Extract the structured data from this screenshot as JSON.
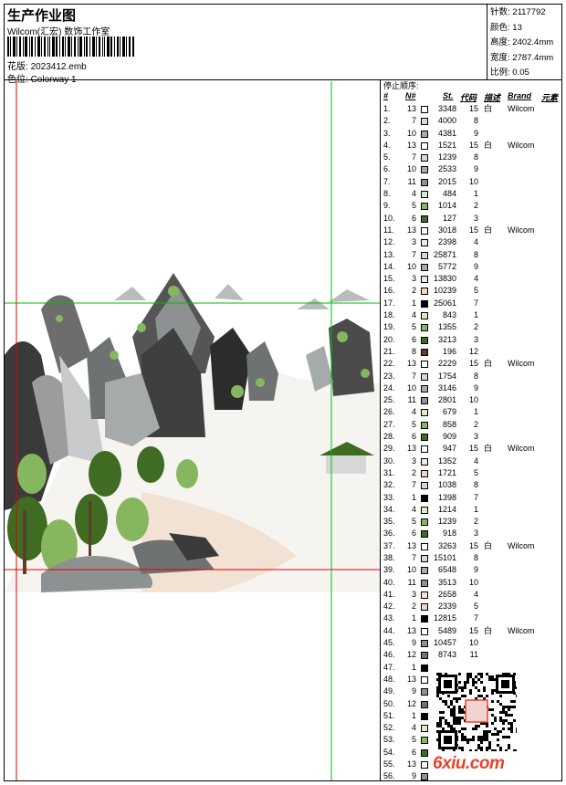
{
  "header": {
    "title": "生产作业图",
    "studio": "Wilcom(汇宏) 数饰工作室",
    "file_label": "花版:",
    "file_name": "2023412.emb",
    "colorway_label": "色位:",
    "colorway_name": "Colorway 1"
  },
  "stats": [
    {
      "label": "针数:",
      "value": "2117792"
    },
    {
      "label": "颜色:",
      "value": "13"
    },
    {
      "label": "高度:",
      "value": "2402.4mm"
    },
    {
      "label": "宽度:",
      "value": "2787.4mm"
    },
    {
      "label": "比例:",
      "value": "0.05"
    }
  ],
  "legend": {
    "title": "停止顺序:",
    "headers": {
      "num": "#",
      "n": "N#",
      "st": "St.",
      "code": "代码",
      "desc": "描述",
      "brand": "Brand",
      "elem": "元素"
    },
    "rows": [
      {
        "no": "1.",
        "n": "13",
        "st": "3348",
        "code": "15",
        "desc": "白",
        "brand": "Wilcom",
        "color": "#ffffff"
      },
      {
        "no": "2.",
        "n": "7",
        "st": "4000",
        "code": "8",
        "desc": "",
        "brand": "",
        "color": "#d6d8d8"
      },
      {
        "no": "3.",
        "n": "10",
        "st": "4381",
        "code": "9",
        "desc": "",
        "brand": "",
        "color": "#a7aaab"
      },
      {
        "no": "4.",
        "n": "13",
        "st": "1521",
        "code": "15",
        "desc": "白",
        "brand": "Wilcom",
        "color": "#ffffff"
      },
      {
        "no": "5.",
        "n": "7",
        "st": "1239",
        "code": "8",
        "desc": "",
        "brand": "",
        "color": "#d6d8d8"
      },
      {
        "no": "6.",
        "n": "10",
        "st": "2533",
        "code": "9",
        "desc": "",
        "brand": "",
        "color": "#a7aaab"
      },
      {
        "no": "7.",
        "n": "11",
        "st": "2015",
        "code": "10",
        "desc": "",
        "brand": "",
        "color": "#8d9192"
      },
      {
        "no": "8.",
        "n": "4",
        "st": "484",
        "code": "1",
        "desc": "",
        "brand": "",
        "color": "#d7edc8"
      },
      {
        "no": "9.",
        "n": "5",
        "st": "1014",
        "code": "2",
        "desc": "",
        "brand": "",
        "color": "#86b75e"
      },
      {
        "no": "10.",
        "n": "6",
        "st": "127",
        "code": "3",
        "desc": "",
        "brand": "",
        "color": "#3f6b22"
      },
      {
        "no": "11.",
        "n": "13",
        "st": "3018",
        "code": "15",
        "desc": "白",
        "brand": "Wilcom",
        "color": "#ffffff"
      },
      {
        "no": "12.",
        "n": "3",
        "st": "2398",
        "code": "4",
        "desc": "",
        "brand": "",
        "color": "#f1e7dc"
      },
      {
        "no": "13.",
        "n": "7",
        "st": "25871",
        "code": "8",
        "desc": "",
        "brand": "",
        "color": "#d6d8d8"
      },
      {
        "no": "14.",
        "n": "10",
        "st": "5772",
        "code": "9",
        "desc": "",
        "brand": "",
        "color": "#a7aaab"
      },
      {
        "no": "15.",
        "n": "3",
        "st": "13830",
        "code": "4",
        "desc": "",
        "brand": "",
        "color": "#f1e7dc"
      },
      {
        "no": "16.",
        "n": "2",
        "st": "10239",
        "code": "5",
        "desc": "",
        "brand": "",
        "color": "#ead8c8"
      },
      {
        "no": "17.",
        "n": "1",
        "st": "25061",
        "code": "7",
        "desc": "",
        "brand": "",
        "color": "#000000"
      },
      {
        "no": "18.",
        "n": "4",
        "st": "843",
        "code": "1",
        "desc": "",
        "brand": "",
        "color": "#d7edc8"
      },
      {
        "no": "19.",
        "n": "5",
        "st": "1355",
        "code": "2",
        "desc": "",
        "brand": "",
        "color": "#86b75e"
      },
      {
        "no": "20.",
        "n": "6",
        "st": "3213",
        "code": "3",
        "desc": "",
        "brand": "",
        "color": "#3f6b22"
      },
      {
        "no": "21.",
        "n": "8",
        "st": "196",
        "code": "12",
        "desc": "",
        "brand": "",
        "color": "#5b3f2a"
      },
      {
        "no": "22.",
        "n": "13",
        "st": "2229",
        "code": "15",
        "desc": "白",
        "brand": "Wilcom",
        "color": "#ffffff"
      },
      {
        "no": "23.",
        "n": "7",
        "st": "1754",
        "code": "8",
        "desc": "",
        "brand": "",
        "color": "#d6d8d8"
      },
      {
        "no": "24.",
        "n": "10",
        "st": "3146",
        "code": "9",
        "desc": "",
        "brand": "",
        "color": "#a7aaab"
      },
      {
        "no": "25.",
        "n": "11",
        "st": "2801",
        "code": "10",
        "desc": "",
        "brand": "",
        "color": "#8d9192"
      },
      {
        "no": "26.",
        "n": "4",
        "st": "679",
        "code": "1",
        "desc": "",
        "brand": "",
        "color": "#d7edc8"
      },
      {
        "no": "27.",
        "n": "5",
        "st": "858",
        "code": "2",
        "desc": "",
        "brand": "",
        "color": "#86b75e"
      },
      {
        "no": "28.",
        "n": "6",
        "st": "909",
        "code": "3",
        "desc": "",
        "brand": "",
        "color": "#3f6b22"
      },
      {
        "no": "29.",
        "n": "13",
        "st": "947",
        "code": "15",
        "desc": "白",
        "brand": "Wilcom",
        "color": "#ffffff"
      },
      {
        "no": "30.",
        "n": "3",
        "st": "1352",
        "code": "4",
        "desc": "",
        "brand": "",
        "color": "#f1e7dc"
      },
      {
        "no": "31.",
        "n": "2",
        "st": "1721",
        "code": "5",
        "desc": "",
        "brand": "",
        "color": "#ead8c8"
      },
      {
        "no": "32.",
        "n": "7",
        "st": "1038",
        "code": "8",
        "desc": "",
        "brand": "",
        "color": "#d6d8d8"
      },
      {
        "no": "33.",
        "n": "1",
        "st": "1398",
        "code": "7",
        "desc": "",
        "brand": "",
        "color": "#000000"
      },
      {
        "no": "34.",
        "n": "4",
        "st": "1214",
        "code": "1",
        "desc": "",
        "brand": "",
        "color": "#d7edc8"
      },
      {
        "no": "35.",
        "n": "5",
        "st": "1239",
        "code": "2",
        "desc": "",
        "brand": "",
        "color": "#86b75e"
      },
      {
        "no": "36.",
        "n": "6",
        "st": "918",
        "code": "3",
        "desc": "",
        "brand": "",
        "color": "#3f6b22"
      },
      {
        "no": "37.",
        "n": "13",
        "st": "3263",
        "code": "15",
        "desc": "白",
        "brand": "Wilcom",
        "color": "#ffffff"
      },
      {
        "no": "38.",
        "n": "7",
        "st": "15101",
        "code": "8",
        "desc": "",
        "brand": "",
        "color": "#d6d8d8"
      },
      {
        "no": "39.",
        "n": "10",
        "st": "6548",
        "code": "9",
        "desc": "",
        "brand": "",
        "color": "#a7aaab"
      },
      {
        "no": "40.",
        "n": "11",
        "st": "3513",
        "code": "10",
        "desc": "",
        "brand": "",
        "color": "#8d9192"
      },
      {
        "no": "41.",
        "n": "3",
        "st": "2658",
        "code": "4",
        "desc": "",
        "brand": "",
        "color": "#f1e7dc"
      },
      {
        "no": "42.",
        "n": "2",
        "st": "2339",
        "code": "5",
        "desc": "",
        "brand": "",
        "color": "#ead8c8"
      },
      {
        "no": "43.",
        "n": "1",
        "st": "12815",
        "code": "7",
        "desc": "",
        "brand": "",
        "color": "#000000"
      },
      {
        "no": "44.",
        "n": "13",
        "st": "5489",
        "code": "15",
        "desc": "白",
        "brand": "Wilcom",
        "color": "#ffffff"
      },
      {
        "no": "45.",
        "n": "9",
        "st": "10457",
        "code": "10",
        "desc": "",
        "brand": "",
        "color": "#8d9192"
      },
      {
        "no": "46.",
        "n": "12",
        "st": "8743",
        "code": "11",
        "desc": "",
        "brand": "",
        "color": "#6f7273"
      },
      {
        "no": "47.",
        "n": "1",
        "st": "",
        "code": "",
        "desc": "",
        "brand": "",
        "color": "#000000"
      },
      {
        "no": "48.",
        "n": "13",
        "st": "",
        "code": "",
        "desc": "",
        "brand": "",
        "color": "#ffffff"
      },
      {
        "no": "49.",
        "n": "9",
        "st": "",
        "code": "",
        "desc": "",
        "brand": "",
        "color": "#8d9192"
      },
      {
        "no": "50.",
        "n": "12",
        "st": "",
        "code": "",
        "desc": "",
        "brand": "",
        "color": "#6f7273"
      },
      {
        "no": "51.",
        "n": "1",
        "st": "",
        "code": "",
        "desc": "",
        "brand": "",
        "color": "#000000"
      },
      {
        "no": "52.",
        "n": "4",
        "st": "",
        "code": "",
        "desc": "",
        "brand": "",
        "color": "#d7edc8"
      },
      {
        "no": "53.",
        "n": "5",
        "st": "",
        "code": "",
        "desc": "",
        "brand": "",
        "color": "#86b75e"
      },
      {
        "no": "54.",
        "n": "6",
        "st": "",
        "code": "",
        "desc": "",
        "brand": "",
        "color": "#3f6b22"
      },
      {
        "no": "55.",
        "n": "13",
        "st": "",
        "code": "",
        "desc": "",
        "brand": "",
        "color": "#ffffff"
      },
      {
        "no": "56.",
        "n": "9",
        "st": "",
        "code": "",
        "desc": "",
        "brand": "",
        "color": "#8d9192"
      }
    ]
  },
  "watermark": "6xiu.com",
  "colors": {
    "guide_red": "#e00000",
    "guide_green": "#00c000",
    "watermark": "#e8432c"
  }
}
